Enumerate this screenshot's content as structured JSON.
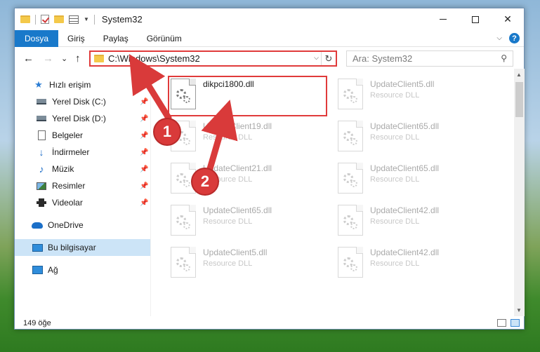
{
  "window": {
    "title": "System32"
  },
  "ribbon": {
    "tabs": [
      "Dosya",
      "Giriş",
      "Paylaş",
      "Görünüm"
    ],
    "help": "?"
  },
  "nav": {
    "back": "←",
    "forward": "→",
    "recent": "⌄",
    "up": "↑",
    "address": "C:\\Windows\\System32",
    "refresh": "↻"
  },
  "search": {
    "placeholder": "Ara: System32"
  },
  "sidebar": {
    "items": [
      {
        "label": "Hızlı erişim"
      },
      {
        "label": "Yerel Disk (C:)",
        "pinned": true
      },
      {
        "label": "Yerel Disk (D:)",
        "pinned": true
      },
      {
        "label": "Belgeler",
        "pinned": true
      },
      {
        "label": "İndirmeler",
        "pinned": true
      },
      {
        "label": "Müzik",
        "pinned": true
      },
      {
        "label": "Resimler",
        "pinned": true
      },
      {
        "label": "Videolar",
        "pinned": true
      },
      {
        "label": "OneDrive"
      },
      {
        "label": "Bu bilgisayar",
        "selected": true
      },
      {
        "label": "Ağ"
      }
    ]
  },
  "files": [
    {
      "name": "dikpci1800.dll",
      "type": "",
      "highlighted": true
    },
    {
      "name": "UpdateClient5.dll",
      "type": "Resource DLL"
    },
    {
      "name": "UpdateClient19.dll",
      "type": "Resource DLL"
    },
    {
      "name": "UpdateClient65.dll",
      "type": "Resource DLL"
    },
    {
      "name": "UpdateClient21.dll",
      "type": "Resource DLL"
    },
    {
      "name": "UpdateClient65.dll",
      "type": "Resource DLL"
    },
    {
      "name": "UpdateClient65.dll",
      "type": "Resource DLL"
    },
    {
      "name": "UpdateClient42.dll",
      "type": "Resource DLL"
    },
    {
      "name": "UpdateClient5.dll",
      "type": "Resource DLL"
    },
    {
      "name": "UpdateClient42.dll",
      "type": "Resource DLL"
    }
  ],
  "status": {
    "count": "149 öğe"
  },
  "callouts": {
    "one": "1",
    "two": "2"
  },
  "colors": {
    "accent": "#1979ca",
    "highlight": "#e03b3b",
    "selection": "#cce4f7"
  }
}
